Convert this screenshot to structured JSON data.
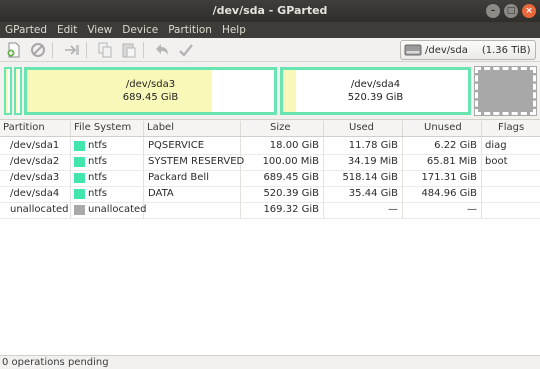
{
  "window": {
    "title": "/dev/sda - GParted"
  },
  "menu": [
    "GParted",
    "Edit",
    "View",
    "Device",
    "Partition",
    "Help"
  ],
  "toolbar": {
    "buttons": [
      "new-partition",
      "delete-partition",
      "resize-move",
      "copy",
      "paste",
      "undo",
      "apply"
    ],
    "device": {
      "name": "/dev/sda",
      "size": "(1.36 TiB)"
    }
  },
  "graphic": {
    "partitions": [
      {
        "name": "/dev/sda3",
        "size": "689.45 GiB",
        "used_fraction": 0.75
      },
      {
        "name": "/dev/sda4",
        "size": "520.39 GiB",
        "used_fraction": 0.07
      }
    ]
  },
  "table": {
    "headers": [
      "Partition",
      "File System",
      "Label",
      "Size",
      "Used",
      "Unused",
      "Flags"
    ],
    "rows": [
      {
        "partition": "/dev/sda1",
        "fs": "ntfs",
        "label": "PQSERVICE",
        "size": "18.00 GiB",
        "used": "11.78 GiB",
        "unused": "6.22 GiB",
        "flags": "diag",
        "color": "#42e5ac"
      },
      {
        "partition": "/dev/sda2",
        "fs": "ntfs",
        "label": "SYSTEM RESERVED",
        "size": "100.00 MiB",
        "used": "34.19 MiB",
        "unused": "65.81 MiB",
        "flags": "boot",
        "color": "#42e5ac"
      },
      {
        "partition": "/dev/sda3",
        "fs": "ntfs",
        "label": "Packard Bell",
        "size": "689.45 GiB",
        "used": "518.14 GiB",
        "unused": "171.31 GiB",
        "flags": "",
        "color": "#42e5ac"
      },
      {
        "partition": "/dev/sda4",
        "fs": "ntfs",
        "label": "DATA",
        "size": "520.39 GiB",
        "used": "35.44 GiB",
        "unused": "484.96 GiB",
        "flags": "",
        "color": "#42e5ac"
      },
      {
        "partition": "unallocated",
        "fs": "unallocated",
        "label": "",
        "size": "169.32 GiB",
        "used": "—",
        "unused": "—",
        "flags": "",
        "color": "#a9a9a9"
      }
    ]
  },
  "status": {
    "text": "0 operations pending"
  },
  "colors": {
    "ntfs": "#42e5ac",
    "unallocated": "#a9a9a9",
    "used_space": "#f8f8b9",
    "titlebar": "#3d3c38",
    "close_button": "#e9683a"
  }
}
